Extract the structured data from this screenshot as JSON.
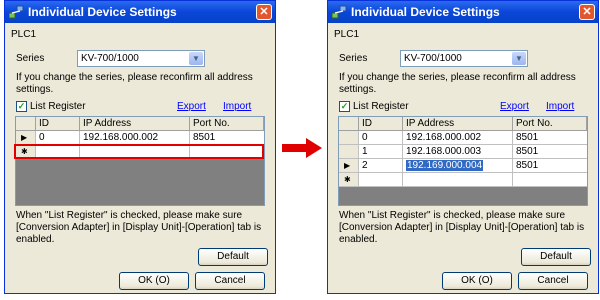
{
  "colors": {
    "titlebar": "#0a46d8",
    "highlight": "#e00000",
    "selection": "#316ac5",
    "arrow": "#e00000"
  },
  "icons": {
    "app": "network-devices-icon",
    "close": "close-x-icon",
    "arrow": "right-arrow-icon"
  },
  "dialogs": [
    {
      "title": "Individual Device Settings",
      "device": "PLC1",
      "series_label": "Series",
      "series_value": "KV-700/1000",
      "note_line1": "If you change the series, please reconfirm all address",
      "note_line2": "settings.",
      "list_register_label": "List Register",
      "export_label": "Export",
      "import_label": "Import",
      "columns": [
        "ID",
        "IP Address",
        "Port No."
      ],
      "rows": [
        {
          "indicator": "▶",
          "id": "0",
          "ip": "192.168.000.002",
          "port": "8501"
        },
        {
          "indicator": "✱",
          "id": "",
          "ip": "",
          "port": ""
        }
      ],
      "footer_line1": "When \"List Register\" is checked, please make sure",
      "footer_line2": "[Conversion Adapter] in [Display Unit]-[Operation] tab is",
      "footer_line3": "enabled.",
      "default_label": "Default",
      "ok_label": "OK (O)",
      "cancel_label": "Cancel"
    },
    {
      "title": "Individual Device Settings",
      "device": "PLC1",
      "series_label": "Series",
      "series_value": "KV-700/1000",
      "note_line1": "If you change the series, please reconfirm all address",
      "note_line2": "settings.",
      "list_register_label": "List Register",
      "export_label": "Export",
      "import_label": "Import",
      "columns": [
        "ID",
        "IP Address",
        "Port No."
      ],
      "rows": [
        {
          "indicator": "",
          "id": "0",
          "ip": "192.168.000.002",
          "port": "8501"
        },
        {
          "indicator": "",
          "id": "1",
          "ip": "192.168.000.003",
          "port": "8501"
        },
        {
          "indicator": "▶",
          "id": "2",
          "ip": "192.169.000.004",
          "port": "8501"
        },
        {
          "indicator": "✱",
          "id": "",
          "ip": "",
          "port": ""
        }
      ],
      "footer_line1": "When \"List Register\" is checked, please make sure",
      "footer_line2": "[Conversion Adapter] in [Display Unit]-[Operation] tab is",
      "footer_line3": "enabled.",
      "default_label": "Default",
      "ok_label": "OK (O)",
      "cancel_label": "Cancel"
    }
  ]
}
